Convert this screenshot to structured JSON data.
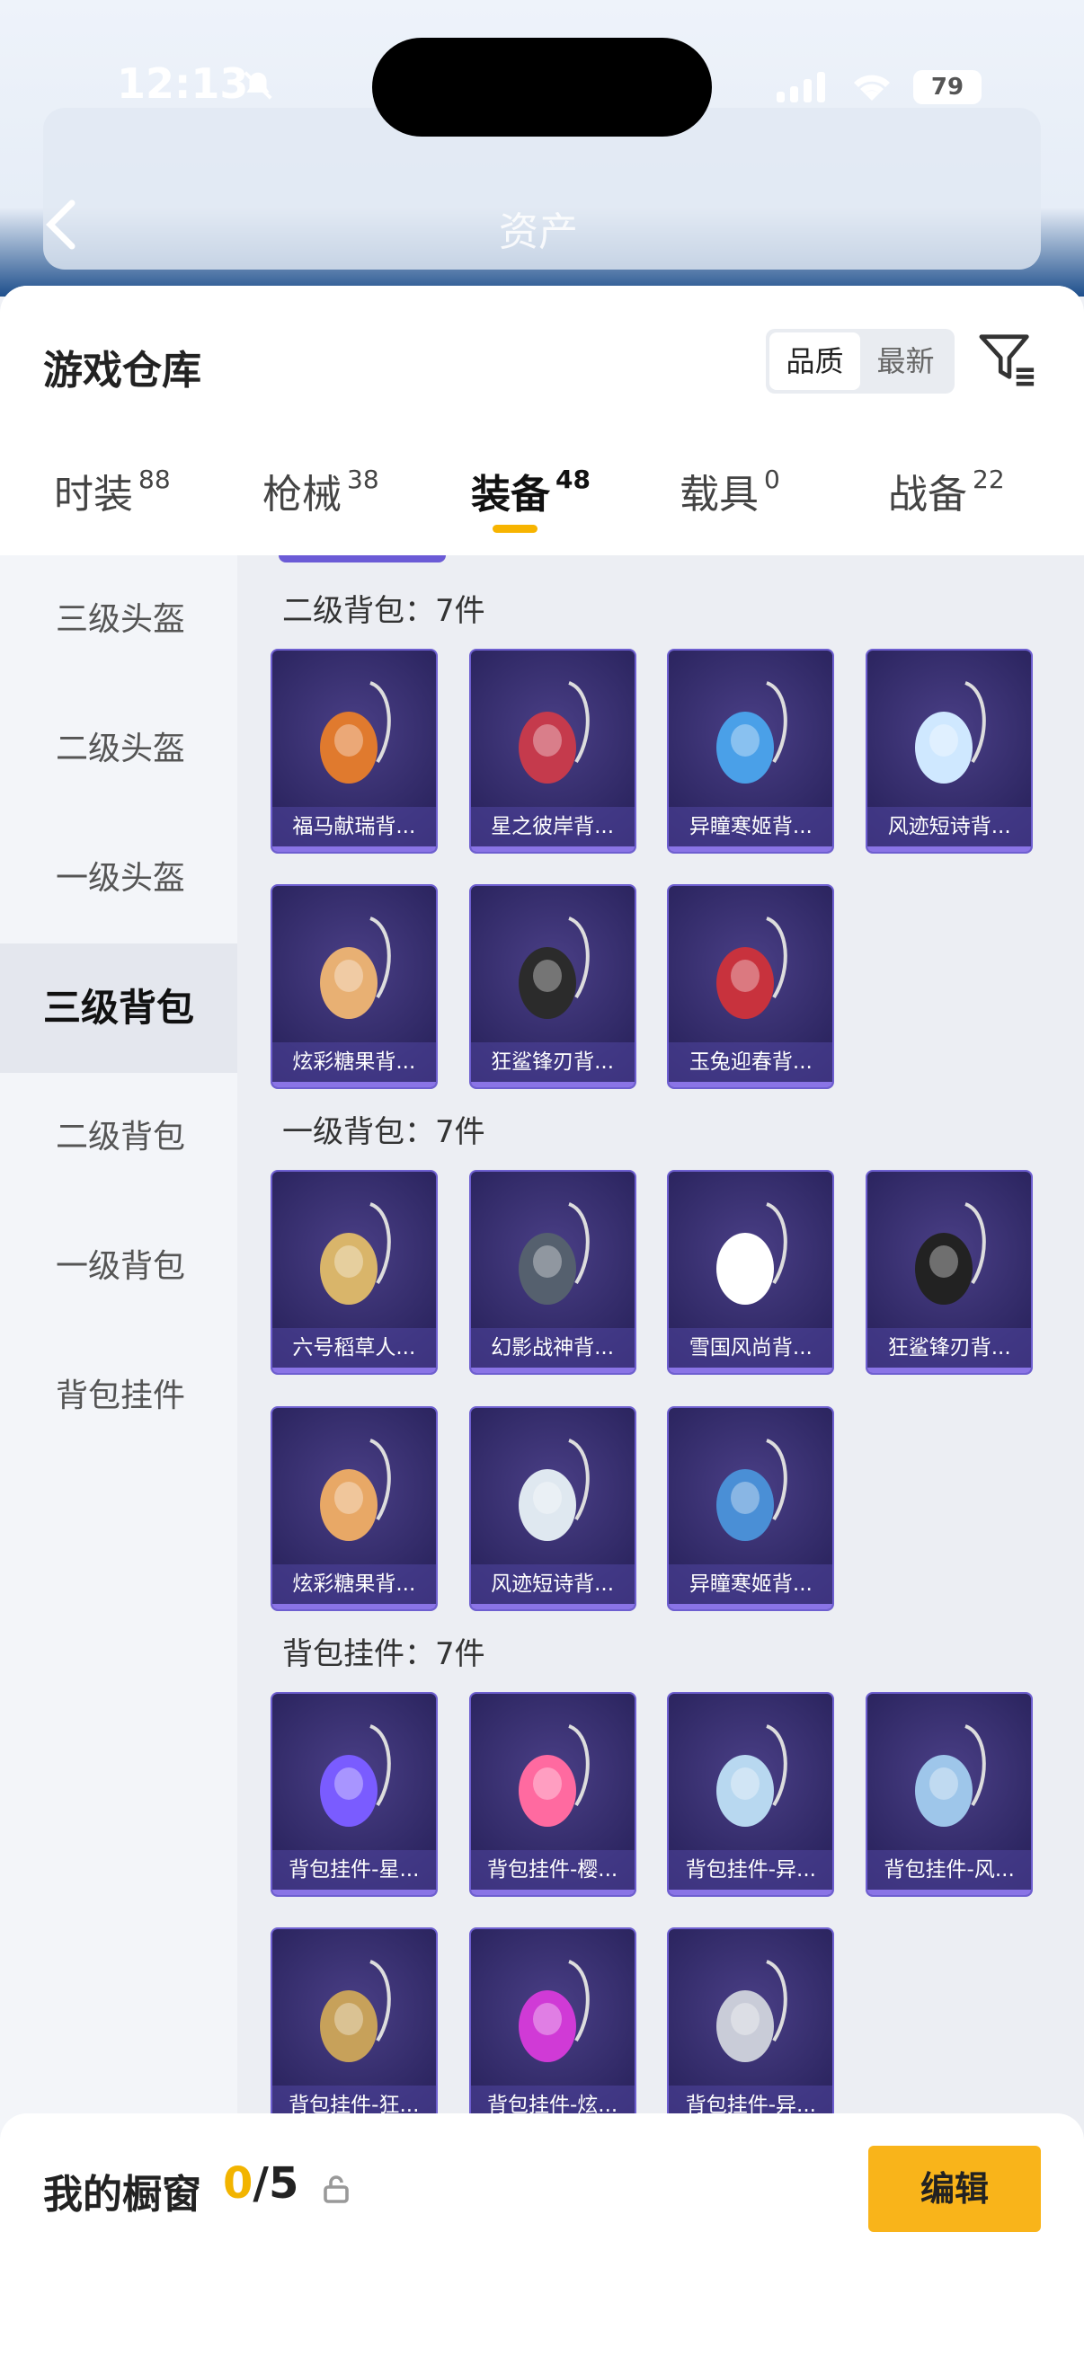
{
  "status_bar": {
    "time": "12:13",
    "battery": "79"
  },
  "background": {
    "title": "资产"
  },
  "sheet": {
    "title": "游戏仓库",
    "sort_options": [
      "品质",
      "最新"
    ],
    "active_sort": "品质"
  },
  "tabs": [
    {
      "label": "时装",
      "count": "88"
    },
    {
      "label": "枪械",
      "count": "38"
    },
    {
      "label": "装备",
      "count": "48"
    },
    {
      "label": "载具",
      "count": "0"
    },
    {
      "label": "战备",
      "count": "22"
    }
  ],
  "active_tab": "装备",
  "sidebar": {
    "items": [
      "三级头盔",
      "二级头盔",
      "一级头盔",
      "三级背包",
      "二级背包",
      "一级背包",
      "背包挂件"
    ],
    "active": "三级背包"
  },
  "sections": [
    {
      "title": "二级背包：7件",
      "items": [
        "福马献瑞背...",
        "星之彼岸背...",
        "异瞳寒姬背...",
        "风迹短诗背...",
        "炫彩糖果背...",
        "狂鲨锋刃背...",
        "玉兔迎春背..."
      ]
    },
    {
      "title": "一级背包：7件",
      "items": [
        "六号稻草人...",
        "幻影战神背...",
        "雪国风尚背...",
        "狂鲨锋刃背...",
        "炫彩糖果背...",
        "风迹短诗背...",
        "异瞳寒姬背..."
      ]
    },
    {
      "title": "背包挂件：7件",
      "items": [
        "背包挂件-星...",
        "背包挂件-樱...",
        "背包挂件-异...",
        "背包挂件-风...",
        "背包挂件-狂...",
        "背包挂件-炫...",
        "背包挂件-异..."
      ]
    }
  ],
  "bottom_bar": {
    "label": "我的橱窗",
    "current": "0",
    "total": "/5",
    "edit_label": "编辑"
  },
  "colors": {
    "accent": "#f9b41a",
    "card_bg": "#2e2763",
    "card_border": "#6e5fd0"
  }
}
